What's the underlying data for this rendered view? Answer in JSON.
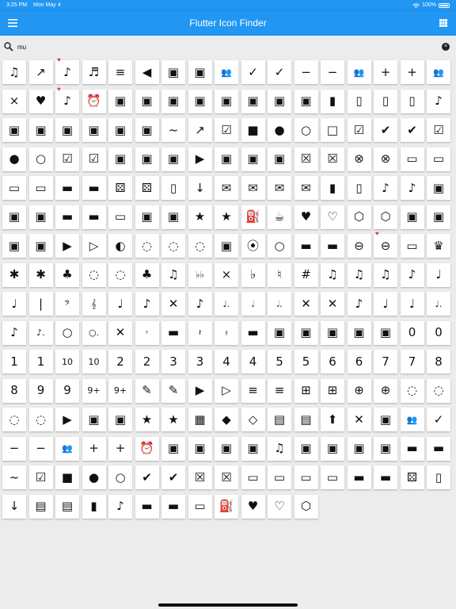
{
  "status": {
    "time": "3:25 PM",
    "date": "Mon May 4",
    "battery": "100%",
    "icons": [
      "wifi-icon",
      "battery-icon"
    ]
  },
  "app": {
    "title": "Flutter Icon Finder",
    "primary_color": "#2196f3",
    "heart_color": "#e53935"
  },
  "search": {
    "value": "mu",
    "placeholder": ""
  },
  "icons": [
    "♫",
    "↗",
    "♪",
    "♬",
    "≡",
    "◀",
    "▣",
    "▣",
    "👥",
    "✓",
    "✓",
    "−",
    "−",
    "👥",
    "+",
    "+",
    "👥",
    "×",
    "♥",
    "♪",
    "⏰",
    "▣",
    "▣",
    "▣",
    "▣",
    "▣",
    "▣",
    "▣",
    "▣",
    "▮",
    "▯",
    "▯",
    "▯",
    "♪",
    "▣",
    "▣",
    "▣",
    "▣",
    "▣",
    "▣",
    "~",
    "↗",
    "☑",
    "■",
    "●",
    "○",
    "□",
    "☑",
    "✔",
    "✔",
    "☑",
    "●",
    "○",
    "☑",
    "☑",
    "▣",
    "▣",
    "▣",
    "▶",
    "▣",
    "▣",
    "▣",
    "☒",
    "☒",
    "⊗",
    "⊗",
    "▭",
    "▭",
    "▭",
    "▭",
    "▬",
    "▬",
    "⚄",
    "⚄",
    "▯",
    "↓",
    "✉",
    "✉",
    "✉",
    "✉",
    "▮",
    "▯",
    "♪",
    "♪",
    "▣",
    "▣",
    "▣",
    "▬",
    "▬",
    "▭",
    "▣",
    "▣",
    "★",
    "★",
    "⛽",
    "☕",
    "♥",
    "♡",
    "⬡",
    "⬡",
    "▣",
    "▣",
    "▣",
    "▣",
    "▶",
    "▷",
    "◐",
    "◌",
    "◌",
    "◌",
    "▣",
    "⦿",
    "○",
    "▬",
    "▬",
    "⊖",
    "⊖",
    "▭",
    "♛",
    "✱",
    "✱",
    "♣",
    "◌",
    "◌",
    "♣",
    "♫",
    "♭♭",
    "×",
    "♭",
    "♮",
    "#",
    "♫",
    "♫",
    "♫",
    "♪",
    "♩",
    "♩",
    "|",
    "𝄢",
    "𝄞",
    "♩",
    "♪",
    "✕",
    "♪",
    "♩.",
    "𝅗𝅥",
    "𝅗𝅥.",
    "✕",
    "✕",
    "♪",
    "♩",
    "♩",
    "♩.",
    "♪",
    "♪.",
    "○",
    "○.",
    "✕",
    "𝄾",
    "▬",
    "𝄽",
    "𝄿",
    "▬",
    "▣",
    "▣",
    "▣",
    "▣",
    "▣",
    "0",
    "0",
    "1",
    "1",
    "10",
    "10",
    "2",
    "2",
    "3",
    "3",
    "4",
    "4",
    "5",
    "5",
    "6",
    "6",
    "7",
    "7",
    "8",
    "8",
    "9",
    "9",
    "9+",
    "9+",
    "✎",
    "✎",
    "▶",
    "▷",
    "≡",
    "≡",
    "⊞",
    "⊞",
    "⊕",
    "⊕",
    "◌",
    "◌",
    "◌",
    "◌",
    "▶",
    "▣",
    "▣",
    "★",
    "★",
    "▦",
    "◆",
    "◇",
    "▤",
    "▤",
    "⬆",
    "✕",
    "▣",
    "👥",
    "✓",
    "−",
    "−",
    "👥",
    "+",
    "+",
    "⏰",
    "▣",
    "▣",
    "▣",
    "▣",
    "♫",
    "▣",
    "▣",
    "▣",
    "▣",
    "▬",
    "▬",
    "~",
    "☑",
    "■",
    "●",
    "○",
    "✔",
    "✔",
    "☒",
    "☒",
    "▭",
    "▭",
    "▭",
    "▭",
    "▬",
    "▬",
    "⚄",
    "▯",
    "↓",
    "▤",
    "▤",
    "▮",
    "♪",
    "▬",
    "▬",
    "▭",
    "⛽",
    "♥",
    "♡",
    "⬡"
  ]
}
